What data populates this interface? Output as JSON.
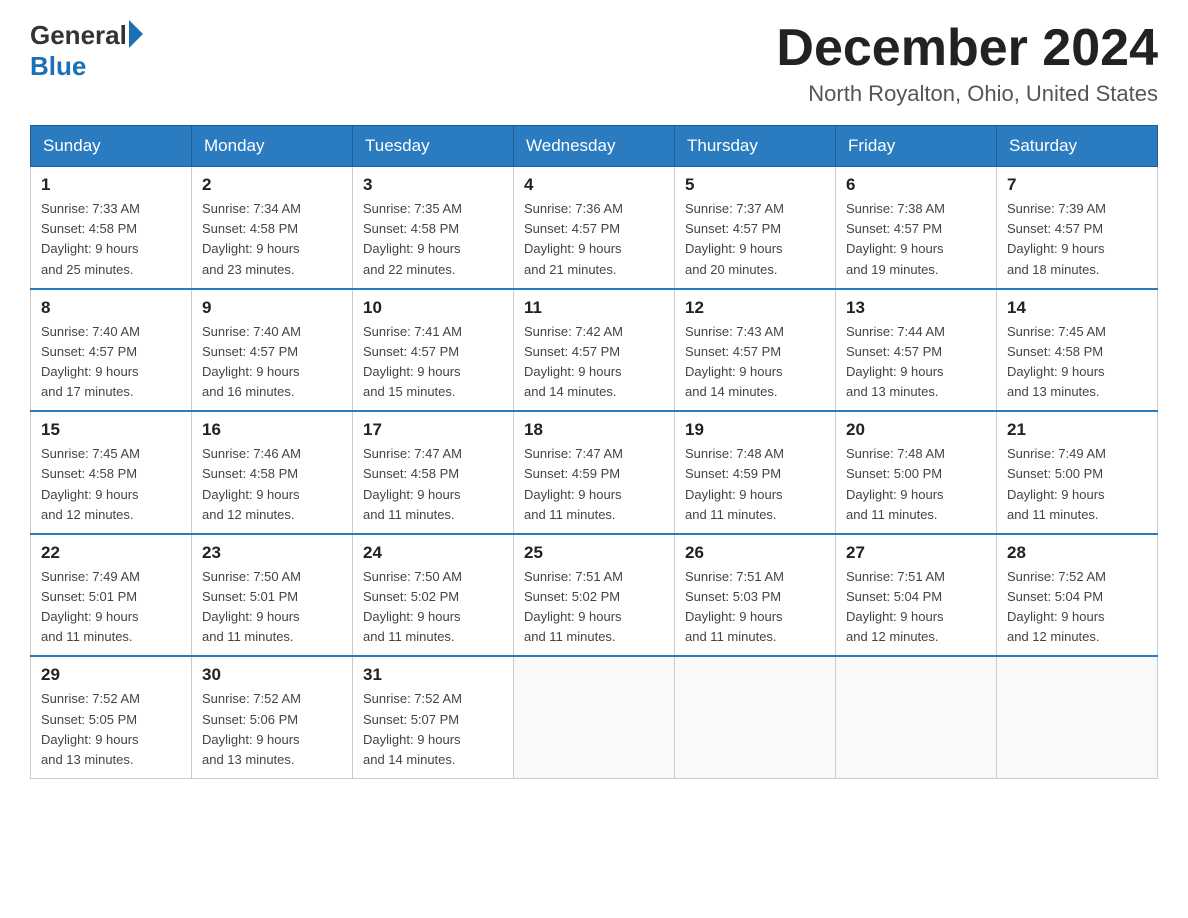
{
  "logo": {
    "general": "General",
    "blue": "Blue"
  },
  "title": "December 2024",
  "location": "North Royalton, Ohio, United States",
  "days_of_week": [
    "Sunday",
    "Monday",
    "Tuesday",
    "Wednesday",
    "Thursday",
    "Friday",
    "Saturday"
  ],
  "weeks": [
    [
      {
        "day": "1",
        "sunrise": "7:33 AM",
        "sunset": "4:58 PM",
        "daylight": "9 hours and 25 minutes."
      },
      {
        "day": "2",
        "sunrise": "7:34 AM",
        "sunset": "4:58 PM",
        "daylight": "9 hours and 23 minutes."
      },
      {
        "day": "3",
        "sunrise": "7:35 AM",
        "sunset": "4:58 PM",
        "daylight": "9 hours and 22 minutes."
      },
      {
        "day": "4",
        "sunrise": "7:36 AM",
        "sunset": "4:57 PM",
        "daylight": "9 hours and 21 minutes."
      },
      {
        "day": "5",
        "sunrise": "7:37 AM",
        "sunset": "4:57 PM",
        "daylight": "9 hours and 20 minutes."
      },
      {
        "day": "6",
        "sunrise": "7:38 AM",
        "sunset": "4:57 PM",
        "daylight": "9 hours and 19 minutes."
      },
      {
        "day": "7",
        "sunrise": "7:39 AM",
        "sunset": "4:57 PM",
        "daylight": "9 hours and 18 minutes."
      }
    ],
    [
      {
        "day": "8",
        "sunrise": "7:40 AM",
        "sunset": "4:57 PM",
        "daylight": "9 hours and 17 minutes."
      },
      {
        "day": "9",
        "sunrise": "7:40 AM",
        "sunset": "4:57 PM",
        "daylight": "9 hours and 16 minutes."
      },
      {
        "day": "10",
        "sunrise": "7:41 AM",
        "sunset": "4:57 PM",
        "daylight": "9 hours and 15 minutes."
      },
      {
        "day": "11",
        "sunrise": "7:42 AM",
        "sunset": "4:57 PM",
        "daylight": "9 hours and 14 minutes."
      },
      {
        "day": "12",
        "sunrise": "7:43 AM",
        "sunset": "4:57 PM",
        "daylight": "9 hours and 14 minutes."
      },
      {
        "day": "13",
        "sunrise": "7:44 AM",
        "sunset": "4:57 PM",
        "daylight": "9 hours and 13 minutes."
      },
      {
        "day": "14",
        "sunrise": "7:45 AM",
        "sunset": "4:58 PM",
        "daylight": "9 hours and 13 minutes."
      }
    ],
    [
      {
        "day": "15",
        "sunrise": "7:45 AM",
        "sunset": "4:58 PM",
        "daylight": "9 hours and 12 minutes."
      },
      {
        "day": "16",
        "sunrise": "7:46 AM",
        "sunset": "4:58 PM",
        "daylight": "9 hours and 12 minutes."
      },
      {
        "day": "17",
        "sunrise": "7:47 AM",
        "sunset": "4:58 PM",
        "daylight": "9 hours and 11 minutes."
      },
      {
        "day": "18",
        "sunrise": "7:47 AM",
        "sunset": "4:59 PM",
        "daylight": "9 hours and 11 minutes."
      },
      {
        "day": "19",
        "sunrise": "7:48 AM",
        "sunset": "4:59 PM",
        "daylight": "9 hours and 11 minutes."
      },
      {
        "day": "20",
        "sunrise": "7:48 AM",
        "sunset": "5:00 PM",
        "daylight": "9 hours and 11 minutes."
      },
      {
        "day": "21",
        "sunrise": "7:49 AM",
        "sunset": "5:00 PM",
        "daylight": "9 hours and 11 minutes."
      }
    ],
    [
      {
        "day": "22",
        "sunrise": "7:49 AM",
        "sunset": "5:01 PM",
        "daylight": "9 hours and 11 minutes."
      },
      {
        "day": "23",
        "sunrise": "7:50 AM",
        "sunset": "5:01 PM",
        "daylight": "9 hours and 11 minutes."
      },
      {
        "day": "24",
        "sunrise": "7:50 AM",
        "sunset": "5:02 PM",
        "daylight": "9 hours and 11 minutes."
      },
      {
        "day": "25",
        "sunrise": "7:51 AM",
        "sunset": "5:02 PM",
        "daylight": "9 hours and 11 minutes."
      },
      {
        "day": "26",
        "sunrise": "7:51 AM",
        "sunset": "5:03 PM",
        "daylight": "9 hours and 11 minutes."
      },
      {
        "day": "27",
        "sunrise": "7:51 AM",
        "sunset": "5:04 PM",
        "daylight": "9 hours and 12 minutes."
      },
      {
        "day": "28",
        "sunrise": "7:52 AM",
        "sunset": "5:04 PM",
        "daylight": "9 hours and 12 minutes."
      }
    ],
    [
      {
        "day": "29",
        "sunrise": "7:52 AM",
        "sunset": "5:05 PM",
        "daylight": "9 hours and 13 minutes."
      },
      {
        "day": "30",
        "sunrise": "7:52 AM",
        "sunset": "5:06 PM",
        "daylight": "9 hours and 13 minutes."
      },
      {
        "day": "31",
        "sunrise": "7:52 AM",
        "sunset": "5:07 PM",
        "daylight": "9 hours and 14 minutes."
      },
      null,
      null,
      null,
      null
    ]
  ],
  "labels": {
    "sunrise": "Sunrise:",
    "sunset": "Sunset:",
    "daylight": "Daylight:"
  }
}
